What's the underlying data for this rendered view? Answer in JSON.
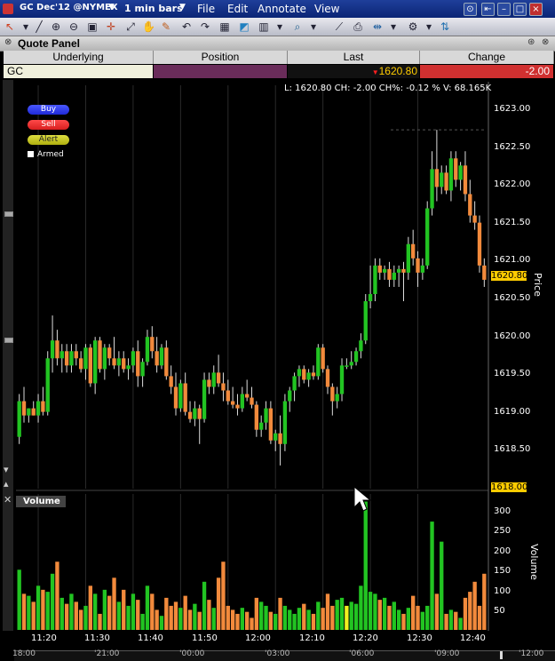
{
  "titlebar": {
    "symbol": "GC Dec'12 @NYMEX",
    "timeframe": "1 min bars",
    "menu": [
      "File",
      "Edit",
      "Annotate",
      "View"
    ]
  },
  "quote_panel": {
    "title": "Quote Panel",
    "columns": [
      "Underlying",
      "Position",
      "Last",
      "Change"
    ],
    "row": {
      "underlying": "GC",
      "position": "",
      "last": "1620.80",
      "change": "-2.00"
    }
  },
  "chart_header": {
    "info": "L: 1620.80  CH: -2.00  CH%: -0.12 %  V: 68.165K"
  },
  "order_buttons": {
    "buy": "Buy",
    "sell": "Sell",
    "alert": "Alert",
    "armed": "Armed"
  },
  "price_axis": {
    "title": "Price",
    "ticks": [
      "1623.00",
      "1622.50",
      "1622.00",
      "1621.50",
      "1621.00",
      "1620.50",
      "1620.00",
      "1619.50",
      "1619.00",
      "1618.50"
    ],
    "last_tag": "1620.80",
    "low_tag": "1618.00"
  },
  "volume_panel": {
    "title": "Volume",
    "axis_title": "Volume",
    "ticks": [
      "300",
      "250",
      "200",
      "150",
      "100",
      "50"
    ]
  },
  "time_axis": {
    "ticks": [
      "11:20",
      "11:30",
      "11:40",
      "11:50",
      "12:00",
      "12:10",
      "12:20",
      "12:30",
      "12:40"
    ],
    "overview_ticks": [
      "18:00",
      "'21:00",
      "'00:00",
      "'03:00",
      "'06:00",
      "'09:00",
      "'12:00"
    ]
  },
  "colors": {
    "up": "#22c422",
    "down": "#f28a3c",
    "up_vol": "#22c422",
    "neutral_vol": "#f0f020",
    "titlebar": "#0b2575",
    "last_arrow": "#ff2020",
    "change_bg": "#d03030",
    "position_bg": "#6a2c5a"
  },
  "chart_data": {
    "type": "candlestick",
    "ylim": [
      1617.9,
      1623.2
    ],
    "volume_ylim": [
      0,
      330
    ],
    "candles": [
      {
        "o": 1618.6,
        "h": 1619.2,
        "l": 1618.5,
        "c": 1619.1,
        "v": 150
      },
      {
        "o": 1619.1,
        "h": 1619.3,
        "l": 1618.8,
        "c": 1618.9,
        "v": 90
      },
      {
        "o": 1618.9,
        "h": 1619.0,
        "l": 1618.8,
        "c": 1619.0,
        "v": 85
      },
      {
        "o": 1619.0,
        "h": 1619.1,
        "l": 1618.9,
        "c": 1618.9,
        "v": 70
      },
      {
        "o": 1618.9,
        "h": 1619.2,
        "l": 1618.8,
        "c": 1619.1,
        "v": 110
      },
      {
        "o": 1619.1,
        "h": 1619.3,
        "l": 1618.9,
        "c": 1618.95,
        "v": 100
      },
      {
        "o": 1618.95,
        "h": 1619.8,
        "l": 1618.9,
        "c": 1619.7,
        "v": 95
      },
      {
        "o": 1619.7,
        "h": 1620.3,
        "l": 1619.5,
        "c": 1619.95,
        "v": 140
      },
      {
        "o": 1619.95,
        "h": 1620.1,
        "l": 1619.6,
        "c": 1619.7,
        "v": 170
      },
      {
        "o": 1619.7,
        "h": 1619.9,
        "l": 1619.5,
        "c": 1619.8,
        "v": 80
      },
      {
        "o": 1619.8,
        "h": 1619.9,
        "l": 1619.5,
        "c": 1619.6,
        "v": 65
      },
      {
        "o": 1619.6,
        "h": 1619.9,
        "l": 1619.5,
        "c": 1619.8,
        "v": 90
      },
      {
        "o": 1619.8,
        "h": 1619.9,
        "l": 1619.6,
        "c": 1619.7,
        "v": 70
      },
      {
        "o": 1619.7,
        "h": 1619.8,
        "l": 1619.5,
        "c": 1619.55,
        "v": 50
      },
      {
        "o": 1619.55,
        "h": 1619.9,
        "l": 1619.4,
        "c": 1619.85,
        "v": 60
      },
      {
        "o": 1619.85,
        "h": 1619.9,
        "l": 1619.3,
        "c": 1619.35,
        "v": 110
      },
      {
        "o": 1619.35,
        "h": 1620.0,
        "l": 1619.2,
        "c": 1619.95,
        "v": 90
      },
      {
        "o": 1619.95,
        "h": 1620.0,
        "l": 1619.5,
        "c": 1619.55,
        "v": 40
      },
      {
        "o": 1619.55,
        "h": 1619.9,
        "l": 1619.4,
        "c": 1619.85,
        "v": 100
      },
      {
        "o": 1619.85,
        "h": 1619.9,
        "l": 1619.6,
        "c": 1619.7,
        "v": 85
      },
      {
        "o": 1619.7,
        "h": 1620.0,
        "l": 1619.55,
        "c": 1619.6,
        "v": 130
      },
      {
        "o": 1619.6,
        "h": 1619.8,
        "l": 1619.45,
        "c": 1619.7,
        "v": 70
      },
      {
        "o": 1619.7,
        "h": 1619.8,
        "l": 1619.5,
        "c": 1619.55,
        "v": 100
      },
      {
        "o": 1619.55,
        "h": 1619.7,
        "l": 1619.4,
        "c": 1619.6,
        "v": 60
      },
      {
        "o": 1619.6,
        "h": 1619.85,
        "l": 1619.5,
        "c": 1619.8,
        "v": 90
      },
      {
        "o": 1619.8,
        "h": 1619.95,
        "l": 1619.3,
        "c": 1619.45,
        "v": 75
      },
      {
        "o": 1619.45,
        "h": 1619.7,
        "l": 1619.3,
        "c": 1619.65,
        "v": 40
      },
      {
        "o": 1619.65,
        "h": 1620.1,
        "l": 1619.6,
        "c": 1620.0,
        "v": 110
      },
      {
        "o": 1620.0,
        "h": 1620.15,
        "l": 1619.7,
        "c": 1619.8,
        "v": 90
      },
      {
        "o": 1619.8,
        "h": 1620.0,
        "l": 1619.5,
        "c": 1619.6,
        "v": 50
      },
      {
        "o": 1619.6,
        "h": 1619.9,
        "l": 1619.55,
        "c": 1619.85,
        "v": 35
      },
      {
        "o": 1619.85,
        "h": 1619.95,
        "l": 1619.4,
        "c": 1619.45,
        "v": 80
      },
      {
        "o": 1619.45,
        "h": 1619.6,
        "l": 1619.2,
        "c": 1619.3,
        "v": 60
      },
      {
        "o": 1619.3,
        "h": 1619.5,
        "l": 1618.9,
        "c": 1619.0,
        "v": 70
      },
      {
        "o": 1619.0,
        "h": 1619.4,
        "l": 1618.95,
        "c": 1619.35,
        "v": 55
      },
      {
        "o": 1619.35,
        "h": 1619.5,
        "l": 1618.9,
        "c": 1618.95,
        "v": 85
      },
      {
        "o": 1618.95,
        "h": 1619.1,
        "l": 1618.8,
        "c": 1618.85,
        "v": 50
      },
      {
        "o": 1618.85,
        "h": 1619.1,
        "l": 1618.75,
        "c": 1619.0,
        "v": 65
      },
      {
        "o": 1619.0,
        "h": 1619.05,
        "l": 1618.5,
        "c": 1618.85,
        "v": 45
      },
      {
        "o": 1618.85,
        "h": 1619.5,
        "l": 1618.8,
        "c": 1619.4,
        "v": 120
      },
      {
        "o": 1619.4,
        "h": 1619.5,
        "l": 1619.2,
        "c": 1619.3,
        "v": 75
      },
      {
        "o": 1619.3,
        "h": 1619.6,
        "l": 1619.2,
        "c": 1619.5,
        "v": 55
      },
      {
        "o": 1619.5,
        "h": 1619.75,
        "l": 1619.3,
        "c": 1619.35,
        "v": 130
      },
      {
        "o": 1619.35,
        "h": 1619.5,
        "l": 1619.1,
        "c": 1619.25,
        "v": 170
      },
      {
        "o": 1619.25,
        "h": 1619.4,
        "l": 1619.05,
        "c": 1619.1,
        "v": 60
      },
      {
        "o": 1619.1,
        "h": 1619.3,
        "l": 1619.0,
        "c": 1619.05,
        "v": 50
      },
      {
        "o": 1619.05,
        "h": 1619.2,
        "l": 1618.9,
        "c": 1619.0,
        "v": 40
      },
      {
        "o": 1619.0,
        "h": 1619.3,
        "l": 1618.95,
        "c": 1619.2,
        "v": 55
      },
      {
        "o": 1619.2,
        "h": 1619.4,
        "l": 1619.1,
        "c": 1619.15,
        "v": 45
      },
      {
        "o": 1619.15,
        "h": 1619.3,
        "l": 1619.0,
        "c": 1619.05,
        "v": 30
      },
      {
        "o": 1619.05,
        "h": 1619.1,
        "l": 1618.6,
        "c": 1618.7,
        "v": 80
      },
      {
        "o": 1618.7,
        "h": 1618.9,
        "l": 1618.6,
        "c": 1618.8,
        "v": 70
      },
      {
        "o": 1618.8,
        "h": 1619.1,
        "l": 1618.7,
        "c": 1619.0,
        "v": 60
      },
      {
        "o": 1619.0,
        "h": 1619.1,
        "l": 1618.5,
        "c": 1618.55,
        "v": 45
      },
      {
        "o": 1618.55,
        "h": 1618.7,
        "l": 1618.4,
        "c": 1618.65,
        "v": 40
      },
      {
        "o": 1618.65,
        "h": 1618.9,
        "l": 1618.2,
        "c": 1618.5,
        "v": 80
      },
      {
        "o": 1618.5,
        "h": 1619.2,
        "l": 1618.4,
        "c": 1619.1,
        "v": 60
      },
      {
        "o": 1619.1,
        "h": 1619.3,
        "l": 1618.95,
        "c": 1619.25,
        "v": 50
      },
      {
        "o": 1619.25,
        "h": 1619.5,
        "l": 1619.1,
        "c": 1619.45,
        "v": 40
      },
      {
        "o": 1619.45,
        "h": 1619.6,
        "l": 1619.3,
        "c": 1619.55,
        "v": 55
      },
      {
        "o": 1619.55,
        "h": 1619.6,
        "l": 1619.35,
        "c": 1619.4,
        "v": 65
      },
      {
        "o": 1619.4,
        "h": 1619.55,
        "l": 1619.3,
        "c": 1619.5,
        "v": 50
      },
      {
        "o": 1619.5,
        "h": 1619.6,
        "l": 1619.4,
        "c": 1619.45,
        "v": 40
      },
      {
        "o": 1619.45,
        "h": 1619.9,
        "l": 1619.4,
        "c": 1619.85,
        "v": 70
      },
      {
        "o": 1619.85,
        "h": 1619.9,
        "l": 1619.5,
        "c": 1619.55,
        "v": 55
      },
      {
        "o": 1619.55,
        "h": 1619.6,
        "l": 1619.2,
        "c": 1619.3,
        "v": 90
      },
      {
        "o": 1619.3,
        "h": 1619.35,
        "l": 1618.9,
        "c": 1619.1,
        "v": 60
      },
      {
        "o": 1619.1,
        "h": 1619.3,
        "l": 1619.0,
        "c": 1619.2,
        "v": 75
      },
      {
        "o": 1619.2,
        "h": 1619.7,
        "l": 1619.1,
        "c": 1619.6,
        "v": 80
      },
      {
        "o": 1619.6,
        "h": 1619.7,
        "l": 1619.55,
        "c": 1619.6,
        "v": 60
      },
      {
        "o": 1619.6,
        "h": 1619.8,
        "l": 1619.55,
        "c": 1619.65,
        "v": 70
      },
      {
        "o": 1619.65,
        "h": 1619.85,
        "l": 1619.6,
        "c": 1619.8,
        "v": 65
      },
      {
        "o": 1619.8,
        "h": 1620.05,
        "l": 1619.7,
        "c": 1619.95,
        "v": 110
      },
      {
        "o": 1619.95,
        "h": 1620.6,
        "l": 1619.9,
        "c": 1620.5,
        "v": 320
      },
      {
        "o": 1620.5,
        "h": 1621.0,
        "l": 1620.4,
        "c": 1620.6,
        "v": 95
      },
      {
        "o": 1620.6,
        "h": 1621.1,
        "l": 1620.5,
        "c": 1621.0,
        "v": 90
      },
      {
        "o": 1621.0,
        "h": 1621.1,
        "l": 1620.8,
        "c": 1620.9,
        "v": 75
      },
      {
        "o": 1620.9,
        "h": 1621.0,
        "l": 1620.8,
        "c": 1620.95,
        "v": 80
      },
      {
        "o": 1620.95,
        "h": 1621.05,
        "l": 1620.7,
        "c": 1620.8,
        "v": 60
      },
      {
        "o": 1620.8,
        "h": 1621.0,
        "l": 1620.7,
        "c": 1620.9,
        "v": 70
      },
      {
        "o": 1620.9,
        "h": 1621.0,
        "l": 1620.7,
        "c": 1620.95,
        "v": 50
      },
      {
        "o": 1620.95,
        "h": 1621.05,
        "l": 1620.5,
        "c": 1620.9,
        "v": 40
      },
      {
        "o": 1620.9,
        "h": 1621.4,
        "l": 1620.8,
        "c": 1621.3,
        "v": 55
      },
      {
        "o": 1621.3,
        "h": 1621.5,
        "l": 1621.0,
        "c": 1621.1,
        "v": 85
      },
      {
        "o": 1621.1,
        "h": 1621.2,
        "l": 1620.7,
        "c": 1620.9,
        "v": 60
      },
      {
        "o": 1620.9,
        "h": 1621.1,
        "l": 1620.8,
        "c": 1621.0,
        "v": 45
      },
      {
        "o": 1621.0,
        "h": 1621.9,
        "l": 1620.95,
        "c": 1621.8,
        "v": 60
      },
      {
        "o": 1621.8,
        "h": 1622.6,
        "l": 1621.7,
        "c": 1622.35,
        "v": 270
      },
      {
        "o": 1622.35,
        "h": 1622.9,
        "l": 1621.9,
        "c": 1622.1,
        "v": 90
      },
      {
        "o": 1622.1,
        "h": 1622.4,
        "l": 1622.0,
        "c": 1622.3,
        "v": 220
      },
      {
        "o": 1622.3,
        "h": 1622.4,
        "l": 1622.0,
        "c": 1622.05,
        "v": 40
      },
      {
        "o": 1622.05,
        "h": 1622.6,
        "l": 1621.9,
        "c": 1622.5,
        "v": 50
      },
      {
        "o": 1622.5,
        "h": 1622.6,
        "l": 1622.1,
        "c": 1622.2,
        "v": 45
      },
      {
        "o": 1622.2,
        "h": 1622.45,
        "l": 1622.05,
        "c": 1622.4,
        "v": 30
      },
      {
        "o": 1622.4,
        "h": 1622.6,
        "l": 1621.9,
        "c": 1622.0,
        "v": 80
      },
      {
        "o": 1622.0,
        "h": 1622.2,
        "l": 1621.6,
        "c": 1621.7,
        "v": 95
      },
      {
        "o": 1621.7,
        "h": 1621.9,
        "l": 1621.5,
        "c": 1621.6,
        "v": 120
      },
      {
        "o": 1621.6,
        "h": 1621.7,
        "l": 1620.9,
        "c": 1621.0,
        "v": 60
      },
      {
        "o": 1621.0,
        "h": 1621.1,
        "l": 1620.7,
        "c": 1620.8,
        "v": 140
      }
    ]
  }
}
